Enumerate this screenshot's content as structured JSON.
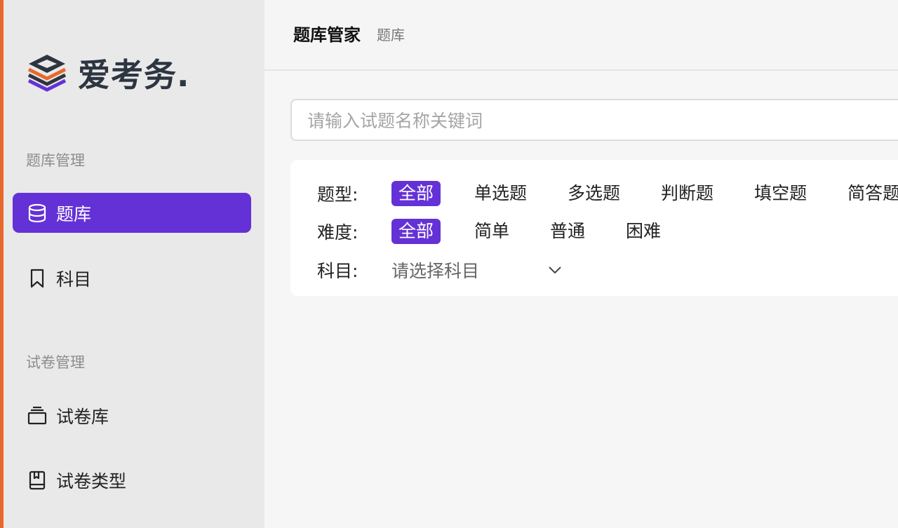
{
  "brand": {
    "name": "爱考务."
  },
  "sidebar": {
    "sections": [
      {
        "label": "题库管理",
        "items": [
          {
            "label": "题库",
            "icon": "database-icon",
            "active": true
          },
          {
            "label": "科目",
            "icon": "bookmark-icon",
            "active": false
          }
        ]
      },
      {
        "label": "试卷管理",
        "items": [
          {
            "label": "试卷库",
            "icon": "layers-icon",
            "active": false
          },
          {
            "label": "试卷类型",
            "icon": "book-icon",
            "active": false
          }
        ]
      }
    ]
  },
  "header": {
    "title": "题库管家",
    "breadcrumb": "题库"
  },
  "search": {
    "placeholder": "请输入试题名称关键词",
    "value": ""
  },
  "filters": {
    "type": {
      "label": "题型:",
      "options": [
        "全部",
        "单选题",
        "多选题",
        "判断题",
        "填空题",
        "简答题"
      ],
      "selected": "全部"
    },
    "difficulty": {
      "label": "难度:",
      "options": [
        "全部",
        "简单",
        "普通",
        "困难"
      ],
      "selected": "全部"
    },
    "subject": {
      "label": "科目:",
      "placeholder": "请选择科目"
    }
  },
  "colors": {
    "accent": "#6431d6",
    "edge": "#e8692c",
    "logo_dark": "#2d3540"
  }
}
